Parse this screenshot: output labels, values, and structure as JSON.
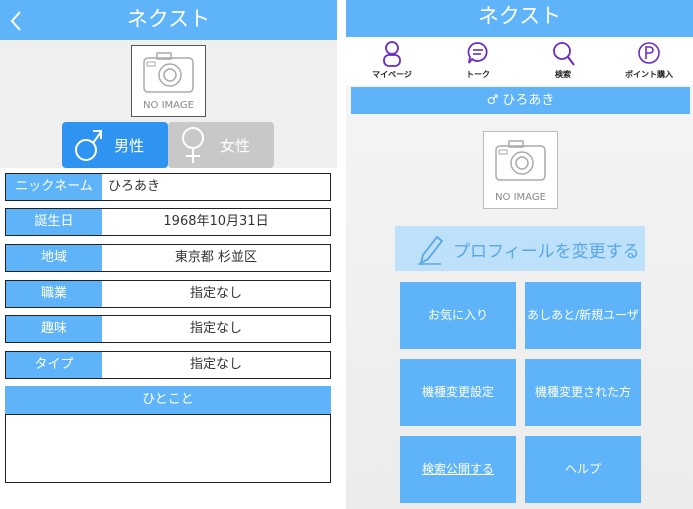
{
  "left": {
    "title": "ネクスト",
    "no_image": "NO IMAGE",
    "gender": {
      "male": "男性",
      "female": "女性"
    },
    "fields": [
      {
        "label": "ニックネーム",
        "value": "ひろあき"
      },
      {
        "label": "誕生日",
        "value": "1968年10月31日"
      },
      {
        "label": "地域",
        "value": "東京都 杉並区"
      },
      {
        "label": "職業",
        "value": "指定なし"
      },
      {
        "label": "趣味",
        "value": "指定なし"
      },
      {
        "label": "タイプ",
        "value": "指定なし"
      }
    ],
    "hitokoto_label": "ひとこと",
    "hitokoto_value": ""
  },
  "right": {
    "title": "ネクスト",
    "nav": [
      {
        "label": "マイページ",
        "icon": "person-icon"
      },
      {
        "label": "トーク",
        "icon": "chat-icon"
      },
      {
        "label": "検索",
        "icon": "search-icon"
      },
      {
        "label": "ポイント購入",
        "icon": "point-icon"
      }
    ],
    "user_name": "♂ ひろあき",
    "no_image": "NO IMAGE",
    "profile_button": "プロフィールを変更する",
    "tiles": [
      "お気に入り",
      "あしあと/新規ユーザー",
      "機種変更設定",
      "機種変更された方",
      "検索公開する",
      "ヘルプ"
    ]
  },
  "colors": {
    "accent": "#5fb4f9",
    "nav_icon": "#6a2bc4",
    "female_button": "#c8c8c8",
    "male_button": "#2f93f2"
  }
}
